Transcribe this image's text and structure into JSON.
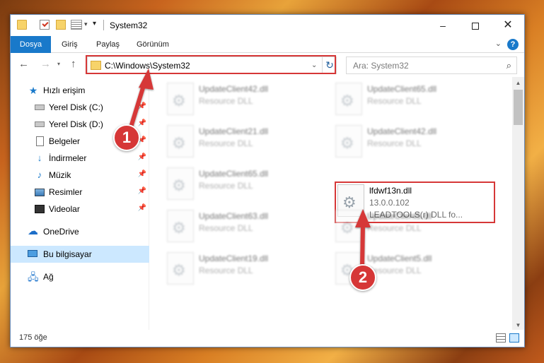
{
  "window": {
    "title": "System32",
    "controls": {
      "minimize": "–",
      "close": "✕"
    }
  },
  "ribbon": {
    "tabs": [
      "Dosya",
      "Giriş",
      "Paylaş",
      "Görünüm"
    ],
    "help": "?"
  },
  "navbar": {
    "address": "C:\\Windows\\System32",
    "search_placeholder": "Ara: System32"
  },
  "sidebar": {
    "items": [
      {
        "label": "Hızlı erişim",
        "icon": "star-icon"
      },
      {
        "label": "Yerel Disk (C:)",
        "icon": "drive-icon",
        "pinned": true
      },
      {
        "label": "Yerel Disk (D:)",
        "icon": "drive-icon",
        "pinned": true
      },
      {
        "label": "Belgeler",
        "icon": "document-icon",
        "pinned": true
      },
      {
        "label": "İndirmeler",
        "icon": "download-icon",
        "pinned": true
      },
      {
        "label": "Müzik",
        "icon": "music-icon",
        "pinned": true
      },
      {
        "label": "Resimler",
        "icon": "pictures-icon",
        "pinned": true
      },
      {
        "label": "Videolar",
        "icon": "videos-icon",
        "pinned": true
      },
      {
        "label": "OneDrive",
        "icon": "onedrive-icon"
      },
      {
        "label": "Bu bilgisayar",
        "icon": "computer-icon",
        "selected": true
      },
      {
        "label": "Ağ",
        "icon": "network-icon"
      }
    ]
  },
  "files": [
    {
      "name": "UpdateClient42.dll",
      "type": "Resource DLL"
    },
    {
      "name": "UpdateClient65.dll",
      "type": "Resource DLL"
    },
    {
      "name": "UpdateClient21.dll",
      "type": "Resource DLL"
    },
    {
      "name": "UpdateClient42.dll",
      "type": "Resource DLL"
    },
    {
      "name": "UpdateClient65.dll",
      "type": "Resource DLL"
    },
    {
      "name": "lfdwf13n.dll",
      "version": "13.0.0.102",
      "description": "LEADTOOLS(r) DLL fo..."
    },
    {
      "name": "UpdateClient63.dll",
      "type": "Resource DLL"
    },
    {
      "name": "UpdateClient5.dll",
      "type": "Resource DLL"
    },
    {
      "name": "UpdateClient19.dll",
      "type": "Resource DLL"
    },
    {
      "name": "UpdateClient5.dll",
      "type": "Resource DLL"
    }
  ],
  "status": {
    "item_count": "175 öğe"
  },
  "annotations": {
    "step1": "1",
    "step2": "2",
    "color": "#d63737"
  },
  "colors": {
    "accent": "#1979ca",
    "selection": "#cce8ff"
  }
}
